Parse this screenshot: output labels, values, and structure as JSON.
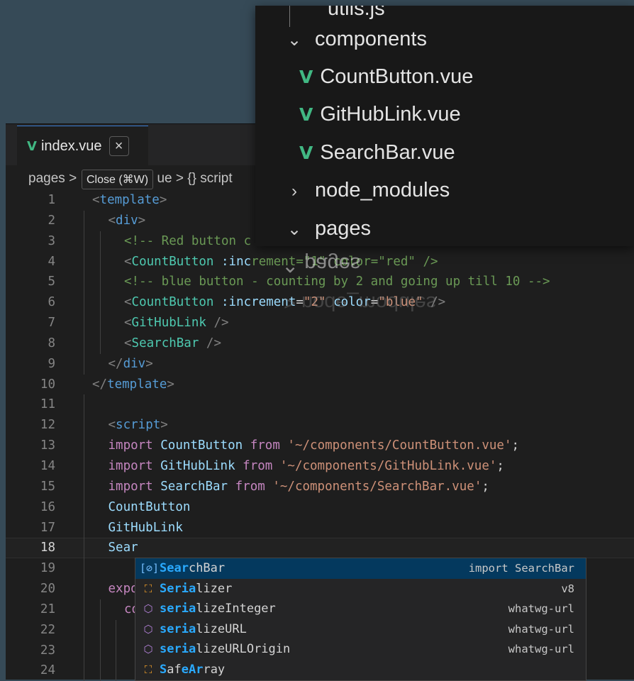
{
  "tab": {
    "label": "index.vue",
    "close": "×"
  },
  "tooltip": "Close (⌘W)",
  "breadcrumb": {
    "root": "pages",
    "sep": ">",
    "file_tail": "ue",
    "braces": "{}",
    "script": "script"
  },
  "code": {
    "lines": [
      {
        "n": "1",
        "ind": 0,
        "tokens": [
          [
            "t-brk",
            "<"
          ],
          [
            "t-tag",
            "template"
          ],
          [
            "t-brk",
            ">"
          ]
        ]
      },
      {
        "n": "2",
        "ind": 1,
        "tokens": [
          [
            "t-brk",
            "<"
          ],
          [
            "t-tag",
            "div"
          ],
          [
            "t-brk",
            ">"
          ]
        ]
      },
      {
        "n": "3",
        "ind": 2,
        "tokens": [
          [
            "t-cmt",
            "<!-- Red button c"
          ]
        ]
      },
      {
        "n": "4",
        "ind": 2,
        "tokens": [
          [
            "t-brk",
            "<"
          ],
          [
            "t-comp",
            "CountButton"
          ],
          [
            "t-plain",
            " "
          ],
          [
            "t-attr",
            ":inc"
          ],
          [
            "t-cmt",
            "rement=\"1\" color=\"red\" />"
          ]
        ]
      },
      {
        "n": "5",
        "ind": 2,
        "tokens": [
          [
            "t-cmt",
            "<!-- blue button - counting by 2 and going up till 10 -->"
          ]
        ]
      },
      {
        "n": "6",
        "ind": 2,
        "tokens": [
          [
            "t-brk",
            "<"
          ],
          [
            "t-comp",
            "CountButton"
          ],
          [
            "t-plain",
            " "
          ],
          [
            "t-attr",
            ":increment"
          ],
          [
            "t-plain",
            "="
          ],
          [
            "t-str",
            "\"2\""
          ],
          [
            "t-plain",
            " "
          ],
          [
            "t-attr",
            "color"
          ],
          [
            "t-plain",
            "="
          ],
          [
            "t-str",
            "\"blue\""
          ],
          [
            "t-plain",
            " "
          ],
          [
            "t-brk",
            "/>"
          ]
        ]
      },
      {
        "n": "7",
        "ind": 2,
        "tokens": [
          [
            "t-brk",
            "<"
          ],
          [
            "t-comp",
            "GitHubLink"
          ],
          [
            "t-plain",
            " "
          ],
          [
            "t-brk",
            "/>"
          ]
        ]
      },
      {
        "n": "8",
        "ind": 2,
        "tokens": [
          [
            "t-brk",
            "<"
          ],
          [
            "t-comp",
            "SearchBar"
          ],
          [
            "t-plain",
            " "
          ],
          [
            "t-brk",
            "/>"
          ]
        ]
      },
      {
        "n": "9",
        "ind": 1,
        "tokens": [
          [
            "t-brk",
            "</"
          ],
          [
            "t-tag",
            "div"
          ],
          [
            "t-brk",
            ">"
          ]
        ]
      },
      {
        "n": "10",
        "ind": 0,
        "tokens": [
          [
            "t-brk",
            "</"
          ],
          [
            "t-tag",
            "template"
          ],
          [
            "t-brk",
            ">"
          ]
        ]
      },
      {
        "n": "11",
        "ind": 1,
        "tokens": []
      },
      {
        "n": "12",
        "ind": 1,
        "tokens": [
          [
            "t-brk",
            "<"
          ],
          [
            "t-tag",
            "script"
          ],
          [
            "t-brk",
            ">"
          ]
        ]
      },
      {
        "n": "13",
        "ind": 1,
        "tokens": [
          [
            "t-kw",
            "import"
          ],
          [
            "t-plain",
            " "
          ],
          [
            "t-id",
            "CountButton"
          ],
          [
            "t-plain",
            " "
          ],
          [
            "t-kw",
            "from"
          ],
          [
            "t-plain",
            " "
          ],
          [
            "t-str",
            "'~/components/CountButton.vue'"
          ],
          [
            "t-plain",
            ";"
          ]
        ]
      },
      {
        "n": "14",
        "ind": 1,
        "tokens": [
          [
            "t-kw",
            "import"
          ],
          [
            "t-plain",
            " "
          ],
          [
            "t-id",
            "GitHubLink"
          ],
          [
            "t-plain",
            " "
          ],
          [
            "t-kw",
            "from"
          ],
          [
            "t-plain",
            " "
          ],
          [
            "t-str",
            "'~/components/GitHubLink.vue'"
          ],
          [
            "t-plain",
            ";"
          ]
        ]
      },
      {
        "n": "15",
        "ind": 1,
        "tokens": [
          [
            "t-kw",
            "import"
          ],
          [
            "t-plain",
            " "
          ],
          [
            "t-id",
            "SearchBar"
          ],
          [
            "t-plain",
            " "
          ],
          [
            "t-kw",
            "from"
          ],
          [
            "t-plain",
            " "
          ],
          [
            "t-str",
            "'~/components/SearchBar.vue'"
          ],
          [
            "t-plain",
            ";"
          ]
        ]
      },
      {
        "n": "16",
        "ind": 1,
        "tokens": [
          [
            "t-id",
            "CountButton"
          ]
        ]
      },
      {
        "n": "17",
        "ind": 1,
        "tokens": [
          [
            "t-id",
            "GitHubLink"
          ]
        ]
      },
      {
        "n": "18",
        "ind": 1,
        "cur": true,
        "tokens": [
          [
            "t-id",
            "Sear"
          ]
        ]
      },
      {
        "n": "19",
        "ind": 1,
        "tokens": []
      },
      {
        "n": "20",
        "ind": 1,
        "tokens": [
          [
            "t-kw",
            "expo"
          ]
        ]
      },
      {
        "n": "21",
        "ind": 2,
        "tokens": [
          [
            "t-kw",
            "co"
          ]
        ]
      },
      {
        "n": "22",
        "ind": 3,
        "tokens": []
      },
      {
        "n": "23",
        "ind": 3,
        "tokens": []
      },
      {
        "n": "24",
        "ind": 3,
        "tokens": []
      }
    ]
  },
  "suggestions": [
    {
      "icon": "[⊘]",
      "icon_name": "variable-icon",
      "icon_color": "#75beff",
      "match": "Sear",
      "rest": "chBar",
      "detail": "import SearchBar",
      "selected": true
    },
    {
      "icon": "⛶",
      "icon_name": "class-icon",
      "icon_color": "#ee9d28",
      "match": "Seria",
      "rest": "lizer",
      "detail": "v8"
    },
    {
      "icon": "⬡",
      "icon_name": "method-icon",
      "icon_color": "#b180d7",
      "match": "seria",
      "rest": "lizeInteger",
      "detail": "whatwg-url"
    },
    {
      "icon": "⬡",
      "icon_name": "method-icon",
      "icon_color": "#b180d7",
      "match": "seria",
      "rest": "lizeURL",
      "detail": "whatwg-url"
    },
    {
      "icon": "⬡",
      "icon_name": "method-icon",
      "icon_color": "#b180d7",
      "match": "seria",
      "rest": "lizeURLOrigin",
      "detail": "whatwg-url"
    },
    {
      "icon": "⛶",
      "icon_name": "class-icon",
      "icon_color": "#ee9d28",
      "match": "S",
      "rest": "af",
      "match2": "eAr",
      "rest2": "ray",
      "detail": ""
    }
  ],
  "explorer": {
    "items": [
      {
        "label": "utils.js",
        "kind": "partial"
      },
      {
        "label": "components",
        "kind": "folder-open"
      },
      {
        "label": "CountButton.vue",
        "kind": "vue"
      },
      {
        "label": "GitHubLink.vue",
        "kind": "vue"
      },
      {
        "label": "SearchBar.vue",
        "kind": "vue"
      },
      {
        "label": "node_modules",
        "kind": "folder-closed"
      },
      {
        "label": "pages",
        "kind": "folder-open"
      }
    ],
    "ghost_primary": "⌃ pages",
    "ghost_secondary": "> node_modules"
  },
  "colors": {
    "accent": "#3b7fd6",
    "vue": "#41b883",
    "selection": "#04395e",
    "match": "#2aaaff"
  }
}
